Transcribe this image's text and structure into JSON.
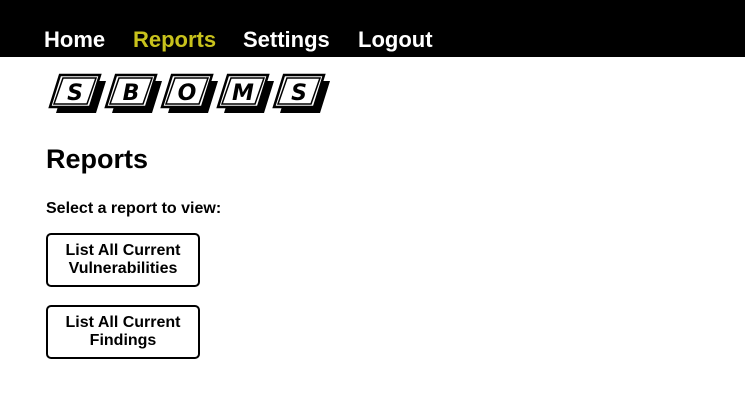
{
  "nav": {
    "items": [
      {
        "label": "Home",
        "active": false
      },
      {
        "label": "Reports",
        "active": true
      },
      {
        "label": "Settings",
        "active": false
      },
      {
        "label": "Logout",
        "active": false
      }
    ],
    "active_color": "#c8c21c",
    "background": "#000000"
  },
  "logo": {
    "letters": [
      "S",
      "B",
      "O",
      "M",
      "S"
    ]
  },
  "page": {
    "title": "Reports",
    "instructions": "Select a report to view:"
  },
  "reports": [
    {
      "line1": "List All Current",
      "line2": "Vulnerabilities"
    },
    {
      "line1": "List All Current",
      "line2": "Findings"
    }
  ]
}
